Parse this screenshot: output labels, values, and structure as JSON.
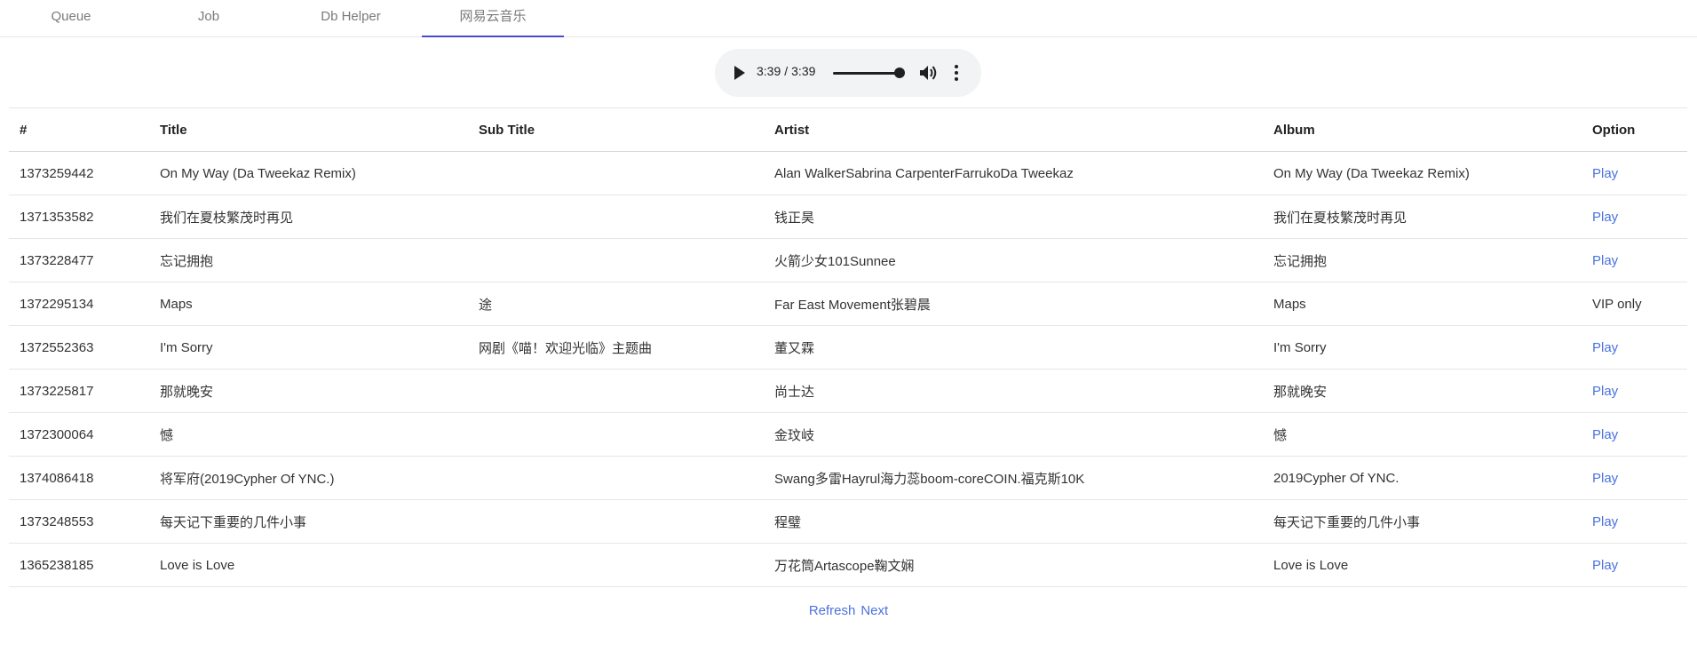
{
  "tabs": [
    {
      "label": "Queue",
      "active": false
    },
    {
      "label": "Job",
      "active": false
    },
    {
      "label": "Db Helper",
      "active": false
    },
    {
      "label": "网易云音乐",
      "active": true
    }
  ],
  "player": {
    "current_time": "3:39",
    "separator": "/",
    "duration": "3:39",
    "progress": 1.0
  },
  "table": {
    "headers": [
      "#",
      "Title",
      "Sub Title",
      "Artist",
      "Album",
      "Option"
    ],
    "rows": [
      {
        "id": "1373259442",
        "title": "On My Way (Da Tweekaz Remix)",
        "subtitle": "",
        "artist": "Alan WalkerSabrina CarpenterFarrukoDa Tweekaz",
        "album": "On My Way (Da Tweekaz Remix)",
        "option": "Play",
        "playable": true
      },
      {
        "id": "1371353582",
        "title": "我们在夏枝繁茂时再见",
        "subtitle": "",
        "artist": "钱正昊",
        "album": "我们在夏枝繁茂时再见",
        "option": "Play",
        "playable": true
      },
      {
        "id": "1373228477",
        "title": "忘记拥抱",
        "subtitle": "",
        "artist": "火箭少女101Sunnee",
        "album": "忘记拥抱",
        "option": "Play",
        "playable": true
      },
      {
        "id": "1372295134",
        "title": "Maps",
        "subtitle": "途",
        "artist": "Far East Movement张碧晨",
        "album": "Maps",
        "option": "VIP only",
        "playable": false
      },
      {
        "id": "1372552363",
        "title": "I'm Sorry",
        "subtitle": "网剧《喵！欢迎光临》主题曲",
        "artist": "董又霖",
        "album": "I'm Sorry",
        "option": "Play",
        "playable": true
      },
      {
        "id": "1373225817",
        "title": "那就晚安",
        "subtitle": "",
        "artist": "尚士达",
        "album": "那就晚安",
        "option": "Play",
        "playable": true
      },
      {
        "id": "1372300064",
        "title": "憾",
        "subtitle": "",
        "artist": "金玟岐",
        "album": "憾",
        "option": "Play",
        "playable": true
      },
      {
        "id": "1374086418",
        "title": "将军府(2019Cypher Of YNC.)",
        "subtitle": "",
        "artist": "Swang多雷Hayrul海力蕊boom-coreCOIN.福克斯10K",
        "album": "2019Cypher Of YNC.",
        "option": "Play",
        "playable": true
      },
      {
        "id": "1373248553",
        "title": "每天记下重要的几件小事",
        "subtitle": "",
        "artist": "程璧",
        "album": "每天记下重要的几件小事",
        "option": "Play",
        "playable": true
      },
      {
        "id": "1365238185",
        "title": "Love is Love",
        "subtitle": "",
        "artist": "万花筒Artascope鞠文娴",
        "album": "Love is Love",
        "option": "Play",
        "playable": true
      }
    ]
  },
  "footer": {
    "refresh_label": "Refresh",
    "next_label": "Next"
  },
  "colors": {
    "accent": "#4a4ad6",
    "link": "#4a72e0",
    "player_bg": "#f1f3f4"
  }
}
